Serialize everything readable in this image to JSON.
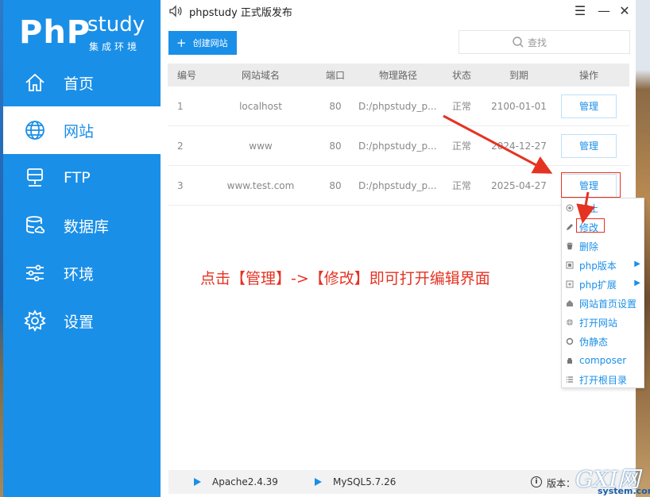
{
  "window": {
    "title": "phpstudy 正式版发布",
    "minimize_glyph": "☰",
    "min_glyph": "—",
    "close_glyph": "✕"
  },
  "logo": {
    "brand": "PhP",
    "word": "study",
    "subtitle": "集成环境"
  },
  "sidebar": {
    "items": [
      {
        "label": "首页",
        "icon": "home-icon",
        "active": false
      },
      {
        "label": "网站",
        "icon": "globe-icon",
        "active": true
      },
      {
        "label": "FTP",
        "icon": "ftp-server-icon",
        "active": false
      },
      {
        "label": "数据库",
        "icon": "database-icon",
        "active": false
      },
      {
        "label": "环境",
        "icon": "sliders-icon",
        "active": false
      },
      {
        "label": "设置",
        "icon": "gear-icon",
        "active": false
      }
    ]
  },
  "toolbar": {
    "create_label": "创建网站",
    "search_placeholder": "查找"
  },
  "table": {
    "headers": [
      "编号",
      "网站域名",
      "端口",
      "物理路径",
      "状态",
      "到期",
      "操作"
    ],
    "rows": [
      {
        "id": "1",
        "domain": "localhost",
        "port": "80",
        "path": "D:/phpstudy_p...",
        "state": "正常",
        "expire": "2100-01-01",
        "op": "管理"
      },
      {
        "id": "2",
        "domain": "www",
        "port": "80",
        "path": "D:/phpstudy_p...",
        "state": "正常",
        "expire": "2024-12-27",
        "op": "管理"
      },
      {
        "id": "3",
        "domain": "www.test.com",
        "port": "80",
        "path": "D:/phpstudy_p...",
        "state": "正常",
        "expire": "2025-04-27",
        "op": "管理"
      }
    ]
  },
  "menu": {
    "items": [
      {
        "label": "停止",
        "icon": "stop-icon",
        "submenu": false
      },
      {
        "label": "修改",
        "icon": "pencil-icon",
        "submenu": false
      },
      {
        "label": "删除",
        "icon": "trash-icon",
        "submenu": false
      },
      {
        "label": "php版本",
        "icon": "php-version-icon",
        "submenu": true
      },
      {
        "label": "php扩展",
        "icon": "php-extension-icon",
        "submenu": true
      },
      {
        "label": "网站首页设置",
        "icon": "home-small-icon",
        "submenu": false
      },
      {
        "label": "打开网站",
        "icon": "globe-small-icon",
        "submenu": false
      },
      {
        "label": "伪静态",
        "icon": "rewrite-icon",
        "submenu": false
      },
      {
        "label": "composer",
        "icon": "composer-icon",
        "submenu": false
      },
      {
        "label": "打开根目录",
        "icon": "list-icon",
        "submenu": false
      }
    ]
  },
  "annotation": "点击【管理】->【修改】即可打开编辑界面",
  "status": {
    "services": [
      "Apache2.4.39",
      "MySQL5.7.26"
    ],
    "version_label": "版本："
  },
  "watermark": {
    "main": "GXI网",
    "sub": "system.com"
  },
  "colors": {
    "accent": "#1a8fe8",
    "highlight": "#e53322"
  }
}
